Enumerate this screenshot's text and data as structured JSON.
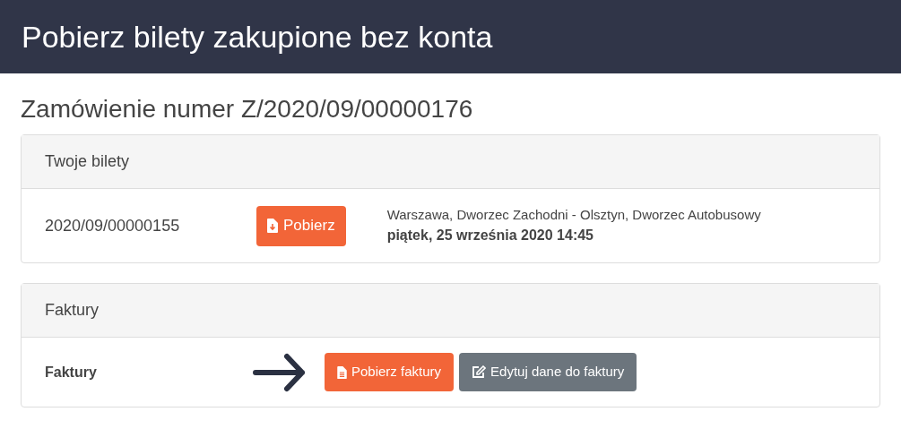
{
  "header": {
    "title": "Pobierz bilety zakupione bez konta"
  },
  "order_title": "Zamówienie numer Z/2020/09/00000176",
  "tickets": {
    "title": "Twoje bilety",
    "rows": [
      {
        "number": "2020/09/00000155",
        "button": "Pobierz",
        "route": "Warszawa, Dworzec Zachodni - Olsztyn, Dworzec Autobusowy",
        "date": "piątek, 25 września 2020 14:45"
      }
    ]
  },
  "invoices": {
    "title": "Faktury",
    "label": "Faktury",
    "buttons": [
      {
        "label": "Pobierz faktury",
        "kind": "primary"
      },
      {
        "label": "Edytuj dane do faktury",
        "kind": "secondary"
      }
    ]
  }
}
